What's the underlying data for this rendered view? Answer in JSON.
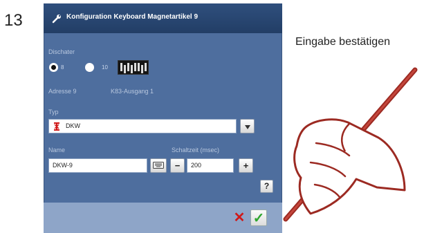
{
  "step_number": "13",
  "callout_text": "Eingabe bestätigen",
  "dialog": {
    "title": "Konfiguration Keyboard Magnetartikel 9",
    "dipswitch_label": "Dischater",
    "radio_options": [
      {
        "label": "8",
        "selected": true
      },
      {
        "label": "10",
        "selected": false
      }
    ],
    "address_label": "Adresse 9",
    "output_label": "K83-Ausgang 1",
    "type_label": "Typ",
    "type_value": "DKW",
    "name_label": "Name",
    "name_value": "DKW-9",
    "switch_time_label": "Schaltzeit (msec)",
    "switch_time_value": "200",
    "minus_label": "−",
    "plus_label": "+",
    "help_label": "?",
    "cancel_symbol": "✕",
    "ok_symbol": "✓",
    "icons": {
      "title": "wrench-icon",
      "type": "turnout-icon",
      "keyboard": "keyboard-icon",
      "dropdown": "chevron-down-icon"
    }
  },
  "colors": {
    "dialog_bg": "#4e6e9e",
    "titlebar_bg": "#2f4f7d",
    "cancel": "#d01818",
    "ok": "#2ea62e",
    "hand_stroke": "#9c2a22"
  }
}
